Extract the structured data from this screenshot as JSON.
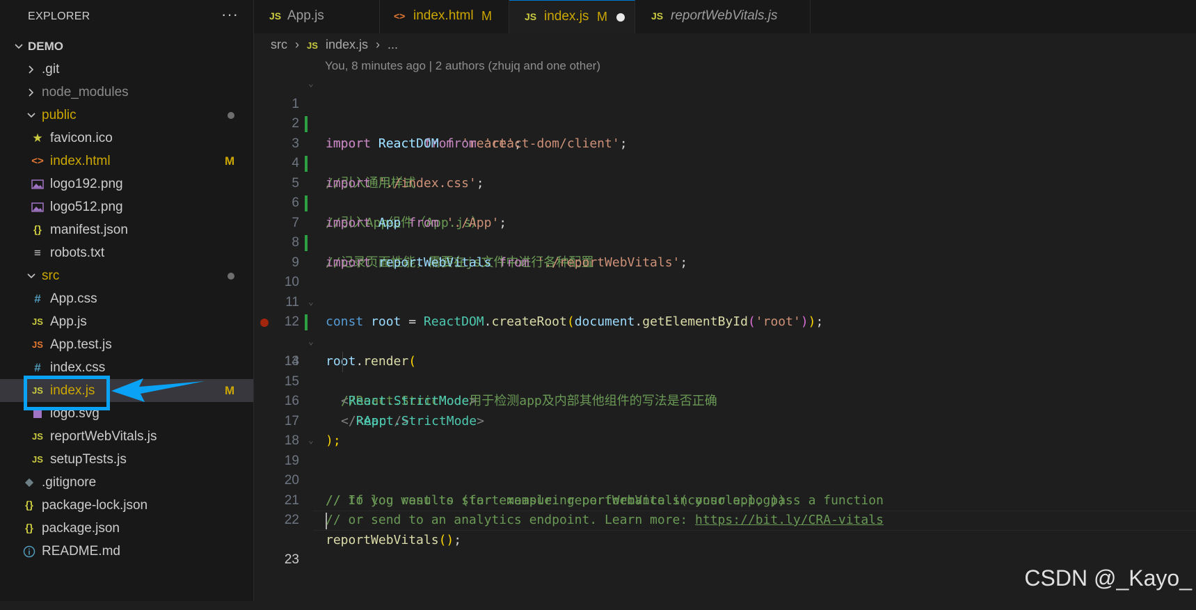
{
  "explorer": {
    "title": "EXPLORER",
    "more_label": "···",
    "root": "DEMO",
    "items": [
      {
        "label": ".git",
        "type": "folder",
        "open": false
      },
      {
        "label": "node_modules",
        "type": "folder",
        "open": false
      },
      {
        "label": "public",
        "type": "folder",
        "open": true
      },
      {
        "label": "favicon.ico",
        "type": "file",
        "icon": "star-icon"
      },
      {
        "label": "index.html",
        "type": "file",
        "icon": "html-icon",
        "status": "M"
      },
      {
        "label": "logo192.png",
        "type": "file",
        "icon": "image-icon"
      },
      {
        "label": "logo512.png",
        "type": "file",
        "icon": "image-icon"
      },
      {
        "label": "manifest.json",
        "type": "file",
        "icon": "json-icon"
      },
      {
        "label": "robots.txt",
        "type": "file",
        "icon": "text-icon"
      },
      {
        "label": "src",
        "type": "folder",
        "open": true
      },
      {
        "label": "App.css",
        "type": "file",
        "icon": "css-icon"
      },
      {
        "label": "App.js",
        "type": "file",
        "icon": "js-icon"
      },
      {
        "label": "App.test.js",
        "type": "file",
        "icon": "js-test-icon"
      },
      {
        "label": "index.css",
        "type": "file",
        "icon": "css-icon"
      },
      {
        "label": "index.js",
        "type": "file",
        "icon": "js-icon",
        "status": "M",
        "selected": true
      },
      {
        "label": "logo.svg",
        "type": "file",
        "icon": "svg-icon"
      },
      {
        "label": "reportWebVitals.js",
        "type": "file",
        "icon": "js-icon"
      },
      {
        "label": "setupTests.js",
        "type": "file",
        "icon": "js-icon"
      },
      {
        "label": ".gitignore",
        "type": "file",
        "icon": "git-icon"
      },
      {
        "label": "package-lock.json",
        "type": "file",
        "icon": "json-icon"
      },
      {
        "label": "package.json",
        "type": "file",
        "icon": "json-icon"
      },
      {
        "label": "README.md",
        "type": "file",
        "icon": "info-icon"
      }
    ]
  },
  "tabs": [
    {
      "label": "App.js",
      "icon": "JS"
    },
    {
      "label": "index.html",
      "icon": "<>",
      "status": "M"
    },
    {
      "label": "index.js",
      "icon": "JS",
      "status": "M",
      "active": true,
      "unsaved": true
    },
    {
      "label": "reportWebVitals.js",
      "icon": "JS"
    }
  ],
  "breadcrumb": {
    "folder": "src",
    "icon": "JS",
    "file": "index.js",
    "tail": "..."
  },
  "codelens": "You, 8 minutes ago | 2 authors (zhujq and one other)",
  "editor": {
    "line_numbers": [
      "1",
      "2",
      "3",
      "4",
      "5",
      "6",
      "7",
      "8",
      "9",
      "10",
      "11",
      "12",
      "13",
      "14",
      "15",
      "16",
      "17",
      "18",
      "19",
      "20",
      "21",
      "22",
      "23"
    ],
    "lines": {
      "l1": {
        "kw": "import",
        "name": "React",
        "from": "from",
        "str": "'react'",
        "end": ";"
      },
      "l2": {
        "kw": "import",
        "name": "ReactDOM",
        "from": "from",
        "str": "'react-dom/client'",
        "end": ";"
      },
      "l3": "//引入通用样式",
      "l4": {
        "kw": "import",
        "str": "'./index.css'",
        "end": ";"
      },
      "l5": "//引入App组件（App.js）",
      "l6": {
        "kw": "import",
        "name": "App",
        "from": "from",
        "str": "'./App'",
        "end": ";"
      },
      "l7": "//记录页面性能，需要在js文件中进行各种配置",
      "l8": {
        "kw": "import",
        "name": "reportWebVitals",
        "from": "from",
        "str": "'./reportWebVitals'",
        "end": ";"
      },
      "l11": {
        "const": "const",
        "name": "root",
        "eq": "=",
        "obj": "ReactDOM",
        "fn": "createRoot",
        "arg_obj": "document",
        "arg_fn": "getElementById",
        "str": "'root'"
      },
      "l12": {
        "obj": "root",
        "fn": "render"
      },
      "l13": "//React.StricMode用于检测app及内部其他组件的写法是否正确",
      "l14": "React.StrictMode",
      "l15": "App",
      "l16": "React.StrictMode",
      "l17": ");",
      "l19": "// If you want to start measuring performance in your app, pass a function",
      "l20": "// to log results (for example: reportWebVitals(console.log))",
      "l21_text": "// or send to an analytics endpoint. Learn more: ",
      "l21_link": "https://bit.ly/CRA-vitals",
      "l22": "reportWebVitals"
    }
  },
  "watermark": "CSDN @_Kayo_",
  "colors": {
    "accent": "#0aa2f5",
    "modified": "#cca700",
    "git_added": "#2ea043"
  }
}
